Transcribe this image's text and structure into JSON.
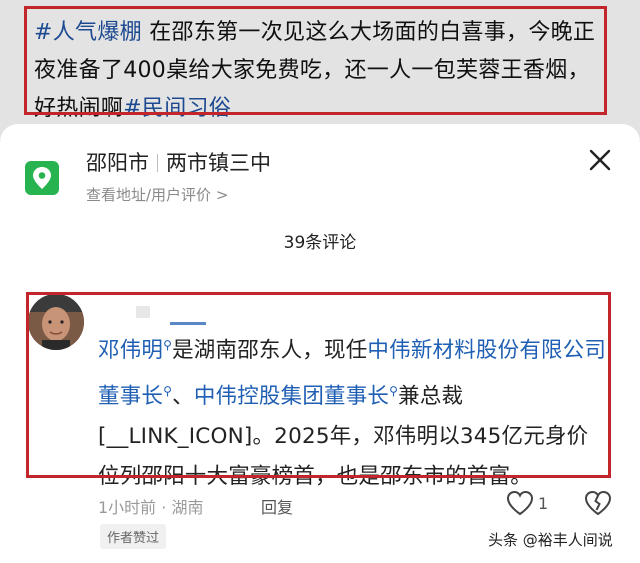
{
  "post": {
    "tag1": "#人气爆棚",
    "text": " 在邵东第一次见这么大场面的白喜事，今晚正夜准备了400桌给大家免费吃，还一人一包芙蓉王香烟，好热闹啊",
    "tag2": "#民间习俗"
  },
  "location": {
    "city": "邵阳市",
    "place": "两市镇三中",
    "sub_link": "查看地址/用户评价 >"
  },
  "comments_header": {
    "count_label": "39条评论"
  },
  "comment": {
    "name_link": "邓伟明",
    "text1": "是湖南邵东人，现任",
    "link2": "中伟新材料股份有限公司董事长",
    "sep": "、",
    "link3": "中伟控股集团董事长",
    "text2": "兼总裁[__LINK_ICON]。2025年，邓伟明以345亿元身价位列邵阳十大富豪榜首，也是邵东市的首富。",
    "meta": "1小时前 · 湖南",
    "reply_label": "回复",
    "like_count": "1",
    "author_liked": "作者赞过"
  },
  "watermark": "头条 @裕丰人间说",
  "colors": {
    "link": "#1f5fb4",
    "highlight_border": "#c2262a",
    "location_icon_bg": "#27b34f"
  },
  "icons": {
    "location": "map-pin-icon",
    "close": "close-icon",
    "search_superscript": "search-icon",
    "like": "heart-icon",
    "dislike": "broken-heart-icon"
  }
}
